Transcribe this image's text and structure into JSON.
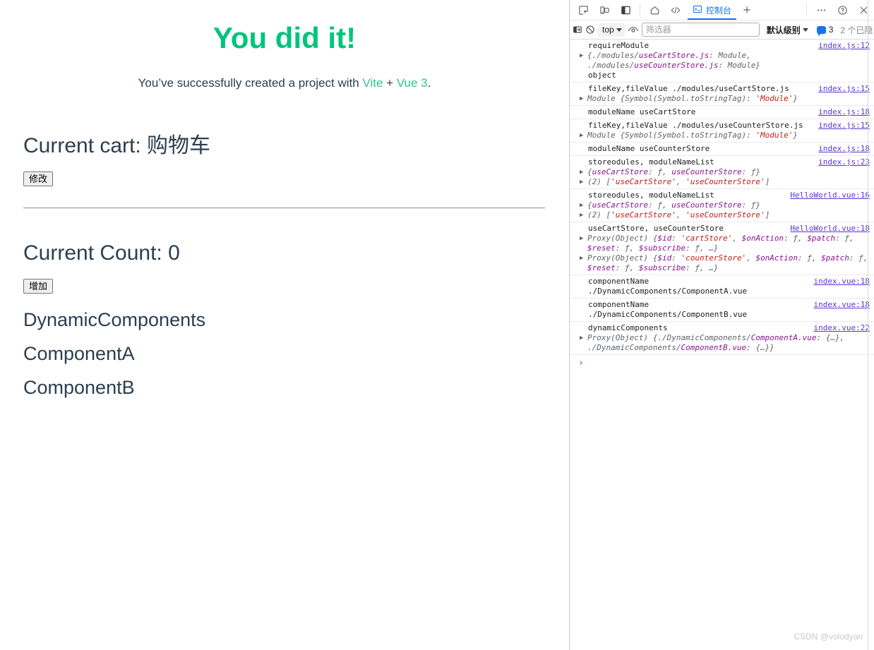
{
  "app": {
    "hero": {
      "title": "You did it!",
      "subtitle_pre": "You’ve successfully created a project with ",
      "link_vite": "Vite",
      "plus": " + ",
      "link_vue": "Vue 3",
      "subtitle_post": ".",
      "accent_color": "#00c47e",
      "link_color": "#2fc48d",
      "text_color": "#2c3e50"
    },
    "cart_section": {
      "heading": "Current cart: 购物车",
      "button_label": "修改"
    },
    "counter_section": {
      "heading": "Current Count: 0",
      "button_label": "增加"
    },
    "dynamic_section": {
      "heading": "DynamicComponents",
      "items": [
        {
          "label": "ComponentA"
        },
        {
          "label": "ComponentB"
        }
      ]
    }
  },
  "devtools": {
    "tabstrip": {
      "inspect_tooltip": "inspect-element",
      "device_tooltip": "device-toolbar",
      "dock_tooltip": "dock-panel",
      "home_tooltip": "home",
      "sources_tooltip": "sources",
      "console_tab_label": "控制台",
      "add_tab_label": "+",
      "more_label": "⋯",
      "help_label": "?",
      "close_label": "×",
      "active_color": "#1a73e8"
    },
    "filterbar": {
      "sidebar_toggle": "sidebar-toggle",
      "clear_console": "clear-console",
      "context_value": "top",
      "eye_label": "live-expression",
      "filter_placeholder": "筛选器",
      "filter_value": "",
      "level_label": "默认级别",
      "issues_count": "3",
      "hidden_note": "2 个已隐"
    },
    "console": {
      "prompt": "›",
      "entries": [
        {
          "message": "requireModule",
          "source": "index.js:12",
          "object_rows": [
            {
              "triangle": true,
              "text": "{./modules/useCartStore.js: Module, ./modules/useCounterStore.js: Module}"
            }
          ],
          "extra": "object"
        },
        {
          "message": "fileKey,fileValue ./modules/useCartStore.js",
          "source": "index.js:15",
          "object_rows": [
            {
              "triangle": true,
              "text": "Module {Symbol(Symbol.toStringTag): 'Module'}"
            }
          ],
          "extra": ""
        },
        {
          "message": "moduleName useCartStore",
          "source": "index.js:18",
          "object_rows": [],
          "extra": ""
        },
        {
          "message": "fileKey,fileValue ./modules/useCounterStore.js",
          "source": "index.js:15",
          "object_rows": [
            {
              "triangle": true,
              "text": "Module {Symbol(Symbol.toStringTag): 'Module'}"
            }
          ],
          "extra": ""
        },
        {
          "message": "moduleName useCounterStore",
          "source": "index.js:18",
          "object_rows": [],
          "extra": ""
        },
        {
          "message": "storeodules, moduleNameList",
          "source": "index.js:23",
          "object_rows": [
            {
              "triangle": true,
              "text": "{useCartStore: ƒ, useCounterStore: ƒ}"
            },
            {
              "triangle": true,
              "text": "(2) ['useCartStore', 'useCounterStore']"
            }
          ],
          "extra": ""
        },
        {
          "message": "storeodules, moduleNameList",
          "source": "HelloWorld.vue:16",
          "object_rows": [
            {
              "triangle": true,
              "text": "{useCartStore: ƒ, useCounterStore: ƒ}"
            },
            {
              "triangle": true,
              "text": "(2) ['useCartStore', 'useCounterStore']"
            }
          ],
          "extra": ""
        },
        {
          "message": "useCartStore, useCounterStore",
          "source": "HelloWorld.vue:18",
          "object_rows": [
            {
              "triangle": true,
              "text": "Proxy(Object) {$id: 'cartStore', $onAction: ƒ, $patch: ƒ, $reset: ƒ, $subscribe: ƒ, …}"
            },
            {
              "triangle": true,
              "text": "Proxy(Object) {$id: 'counterStore', $onAction: ƒ, $patch: ƒ, $reset: ƒ, $subscribe: ƒ, …}"
            }
          ],
          "extra": ""
        },
        {
          "message": "componentName",
          "source": "index.vue:18",
          "object_rows": [],
          "extra": "./DynamicComponents/ComponentA.vue"
        },
        {
          "message": "componentName",
          "source": "index.vue:18",
          "object_rows": [],
          "extra": "./DynamicComponents/ComponentB.vue"
        },
        {
          "message": "dynamicComponents",
          "source": "index.vue:22",
          "object_rows": [
            {
              "triangle": true,
              "text": "Proxy(Object) {./DynamicComponents/ComponentA.vue: {…}, ./DynamicComponents/ComponentB.vue: {…}}"
            }
          ],
          "extra": ""
        }
      ]
    }
  },
  "watermark": "CSDN @volodyan"
}
